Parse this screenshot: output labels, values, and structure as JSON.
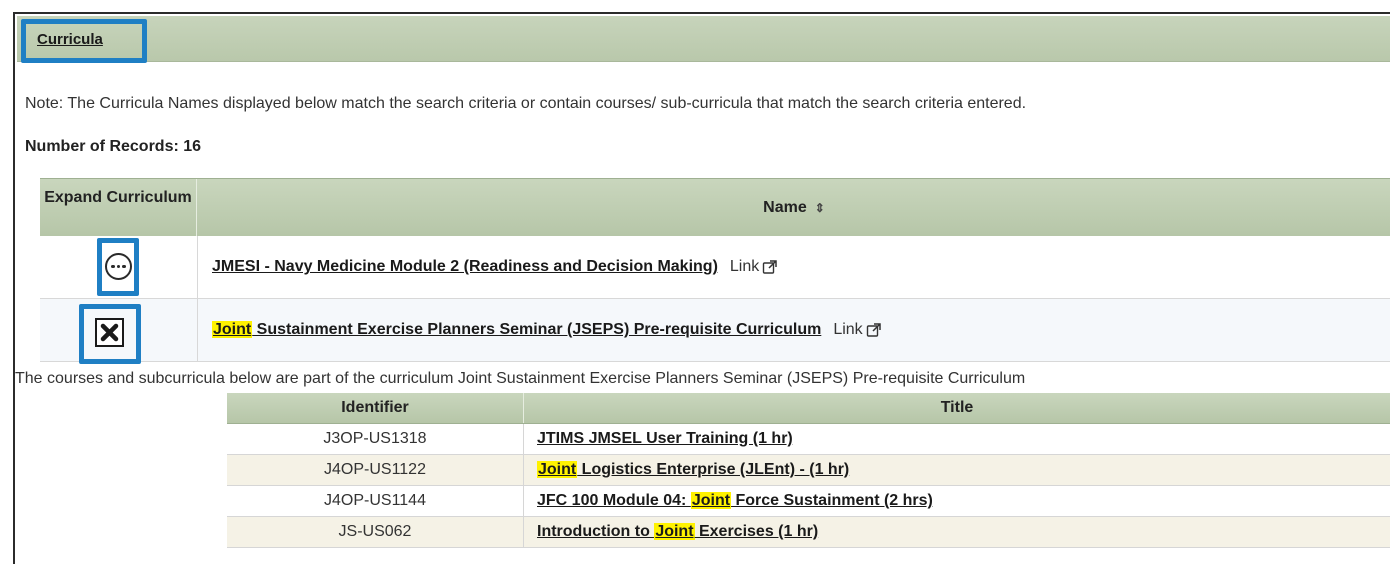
{
  "section": {
    "title": "Curricula"
  },
  "note": "Note: The Curricula Names displayed below match the search criteria or contain courses/ sub-curricula that match the search criteria entered.",
  "records_label": "Number of Records: 16",
  "table": {
    "headers": {
      "expand": "Expand Curriculum",
      "name": "Name",
      "sort_icon": "sort-icon"
    },
    "rows": [
      {
        "name": "JMESI - Navy Medicine Module 2 (Readiness and Decision Making)",
        "link": "Link",
        "state": "collapsed"
      },
      {
        "name_highlight": "Joint",
        "name_rest": " Sustainment Exercise Planners Seminar (JSEPS) Pre-requisite Curriculum",
        "link": "Link",
        "state": "expanded"
      }
    ]
  },
  "expanded_detail": {
    "description": "The courses and subcurricula below are part of the curriculum Joint Sustainment Exercise Planners Seminar (JSEPS) Pre-requisite Curriculum",
    "headers": {
      "identifier": "Identifier",
      "title": "Title"
    },
    "items": [
      {
        "id": "J3OP-US1318",
        "title_pre": "JTIMS JMSEL User Training (1 hr)",
        "highlight": "",
        "title_post": ""
      },
      {
        "id": "J4OP-US1122",
        "title_pre": "",
        "highlight": "Joint",
        "title_post": " Logistics Enterprise (JLEnt) - (1 hr)"
      },
      {
        "id": "J4OP-US1144",
        "title_pre": "JFC 100 Module 04: ",
        "highlight": "Joint",
        "title_post": " Force Sustainment (2 hrs)"
      },
      {
        "id": "JS-US062",
        "title_pre": "Introduction to ",
        "highlight": "Joint",
        "title_post": " Exercises (1 hr)"
      }
    ]
  },
  "colors": {
    "highlight_box": "#1f7fc4",
    "header_green": "#bfcdb2",
    "search_highlight": "#fff200",
    "alt_row": "#f5f2e6"
  }
}
